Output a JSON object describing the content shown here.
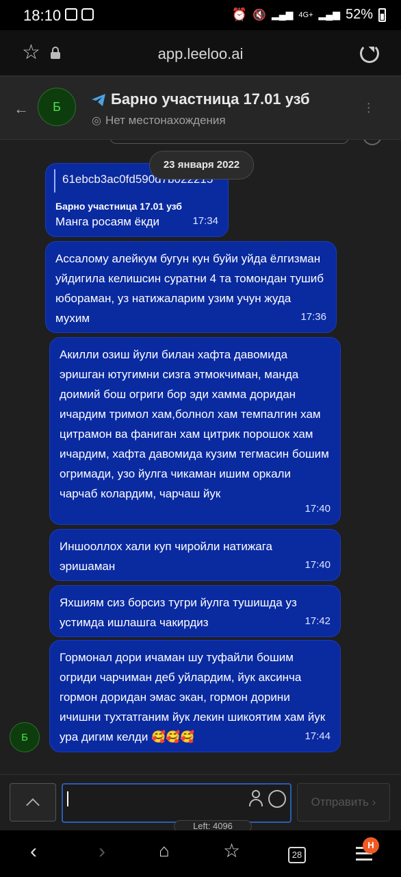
{
  "status_bar": {
    "time": "18:10",
    "network": "4G+",
    "battery": "52%"
  },
  "browser": {
    "url": "app.leeloo.ai",
    "icons": [
      "star-icon",
      "lock-icon",
      "reload-icon"
    ]
  },
  "chat_header": {
    "avatar_letter": "Б",
    "title": "Барно участница 17.01 узб",
    "location": "Нет местонахождения"
  },
  "date_chip": "23 января 2022",
  "messages": [
    {
      "reply_quote": "61ebcb3ac0fd590d7b022215",
      "sender": "Барно участница 17.01 узб",
      "text": "Манга росаям ёкди",
      "time": "17:34"
    },
    {
      "text": "Ассалому алейкум бугун кун буйи уйда ёлгизман уйдигила келишсин суратни 4 та томондан тушиб юбораман, уз натижаларим узим учун жуда мухим",
      "time": "17:36"
    },
    {
      "text": "Акилли озиш йули билан хафта давомида эришган ютугимни сизга этмокчиман, манда доимий бош огриги бор эди хамма доридан ичардим тримол хам,болнол хам темпалгин хам цитрамон ва фаниган хам цитрик порошок хам ичардим, хафта давомида кузим тегмасин бошим огримади, узо йулга чикаман ишим оркали чарчаб колардим, чарчаш йук",
      "time": "17:40"
    },
    {
      "text": "Иншооллох хали куп чиройли натижага эришаман",
      "time": "17:40"
    },
    {
      "text": "Яхшиям сиз борсиз тугри йулга тушишда уз устимда ишлашга чакирдиз",
      "time": "17:42"
    },
    {
      "text": "Гормонал дори ичаман шу туфайли бошим огриди чарчиман деб уйлардим, йук аксинча гормон доридан эмас экан, гормон дорини ичишни тухтатганим йук лекин шикоятим хам йук ура дигим келди 🥰🥰🥰",
      "time": "17:44"
    }
  ],
  "sender_avatar_letter": "Б",
  "compose": {
    "placeholder": "",
    "send_label": "Отправить",
    "left_counter": "Left: 4096"
  },
  "nav": {
    "tabs_count": "28",
    "menu_badge": "H"
  }
}
